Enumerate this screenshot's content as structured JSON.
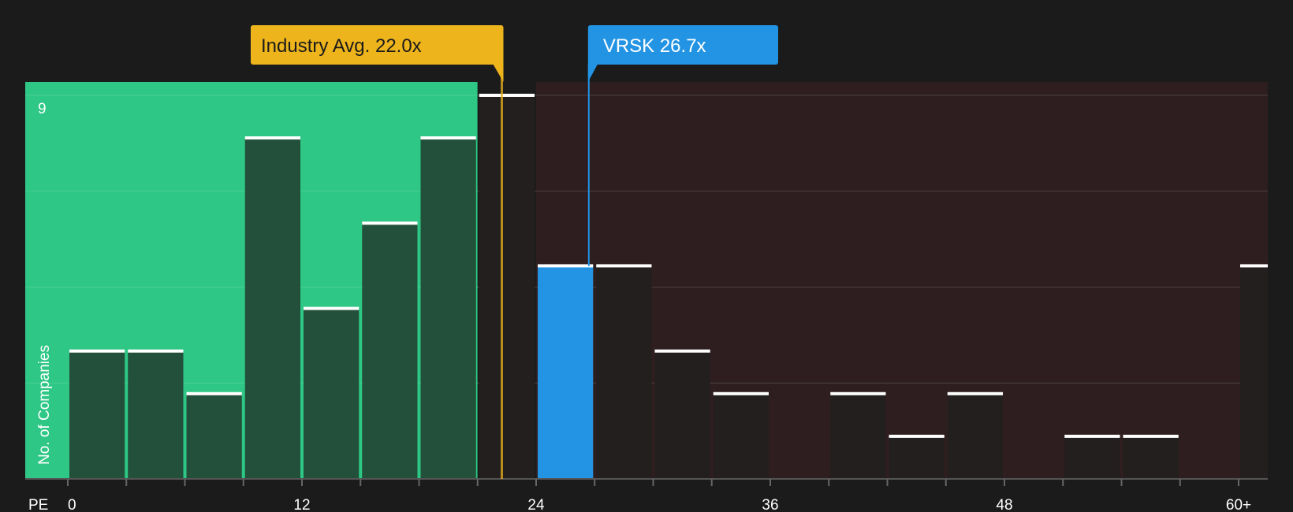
{
  "chart_data": {
    "type": "bar",
    "x_axis_label": "PE",
    "y_axis_label": "No. of Companies",
    "x_ticks": [
      "0",
      "12",
      "24",
      "36",
      "48",
      "60+"
    ],
    "y_tick_labels": [
      "9"
    ],
    "ylim": [
      0,
      9
    ],
    "bin_width": 3,
    "bars": [
      {
        "x_start": 0,
        "value": 3
      },
      {
        "x_start": 3,
        "value": 3
      },
      {
        "x_start": 6,
        "value": 2
      },
      {
        "x_start": 9,
        "value": 8
      },
      {
        "x_start": 12,
        "value": 4
      },
      {
        "x_start": 15,
        "value": 6
      },
      {
        "x_start": 18,
        "value": 8
      },
      {
        "x_start": 21,
        "value": 9
      },
      {
        "x_start": 24,
        "value": 5,
        "highlight": true
      },
      {
        "x_start": 27,
        "value": 5
      },
      {
        "x_start": 30,
        "value": 3
      },
      {
        "x_start": 33,
        "value": 2
      },
      {
        "x_start": 36,
        "value": 0
      },
      {
        "x_start": 39,
        "value": 2
      },
      {
        "x_start": 42,
        "value": 1
      },
      {
        "x_start": 45,
        "value": 2
      },
      {
        "x_start": 48,
        "value": 0
      },
      {
        "x_start": 51,
        "value": 1
      },
      {
        "x_start": 54,
        "value": 1
      },
      {
        "x_start": 57,
        "value": 0
      },
      {
        "x_start": 60,
        "value": 5
      }
    ],
    "industry_avg": {
      "label": "Industry Avg. 22.0x",
      "value": 22.0
    },
    "company": {
      "label": "VRSK 26.7x",
      "value": 26.7
    },
    "colors": {
      "background": "#1b1b1b",
      "below_region": "#2ec785",
      "above_region": "#2f1e1f",
      "bar_in_below": "#23503a",
      "bar_in_above": "#241f1f",
      "highlight_bar": "#2394e3",
      "industry_callout": "#edb41c",
      "company_callout": "#2394e3",
      "bar_cap": "#ffffff",
      "grid": "#4a4040"
    }
  }
}
